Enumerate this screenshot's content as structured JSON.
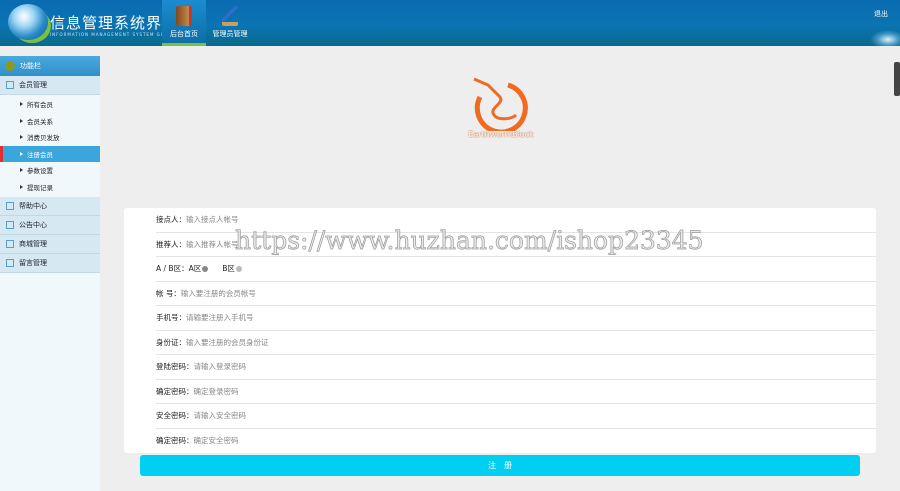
{
  "header": {
    "title": "信息管理系统界面",
    "subtitle": "INFORMATION MANAGEMENT SYSTEM GUI",
    "tabs": [
      {
        "label": "后台首页"
      },
      {
        "label": "管理员管理"
      }
    ],
    "exit": "退出"
  },
  "sidebar": {
    "title": "功能栏",
    "groups": [
      {
        "label": "会员管理",
        "items": [
          "所有会员",
          "会员关系",
          "消费贝发放",
          "注册会员",
          "参数设置",
          "提现记录"
        ]
      },
      {
        "label": "帮助中心"
      },
      {
        "label": "公告中心"
      },
      {
        "label": "商城管理"
      },
      {
        "label": "留言管理"
      }
    ]
  },
  "brand": "EarthwormBlock",
  "form": {
    "rows": [
      {
        "label": "接点人：",
        "placeholder": "输入接点人帐号"
      },
      {
        "label": "推荐人：",
        "placeholder": "输入推荐人帐号"
      },
      {
        "label": "A / B区：",
        "optA": "A区",
        "optB": "B区"
      },
      {
        "label": "帐 号：",
        "placeholder": "输入要注册的会员帐号"
      },
      {
        "label": "手机号：",
        "placeholder": "请输要注册入手机号"
      },
      {
        "label": "身份证：",
        "placeholder": "输入要注册的会员身份证"
      },
      {
        "label": "登陆密码：",
        "placeholder": "请输入登录密码"
      },
      {
        "label": "确定密码：",
        "placeholder": "确定登录密码"
      },
      {
        "label": "安全密码：",
        "placeholder": "请输入安全密码"
      },
      {
        "label": "确定密码：",
        "placeholder": "确定安全密码"
      }
    ],
    "submit": "注　册"
  },
  "watermark": "https://www.huzhan.com/ishop23345"
}
